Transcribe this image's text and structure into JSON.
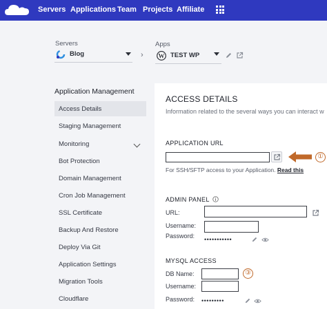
{
  "nav": {
    "logo_icon": "cloud-logo-icon",
    "items": [
      "Servers",
      "Applications",
      "Team",
      "Projects",
      "Affiliate"
    ],
    "apps_grid_icon": "grid-menu-icon"
  },
  "selectors": {
    "servers": {
      "caption": "Servers",
      "value": "Blog",
      "icon": "server-icon"
    },
    "apps": {
      "caption": "Apps",
      "value": "TEST WP",
      "icon": "wordpress-icon"
    },
    "separator": "›"
  },
  "sidebar": {
    "title": "Application Management",
    "items": [
      {
        "label": "Access Details",
        "active": true
      },
      {
        "label": "Staging Management"
      },
      {
        "label": "Monitoring",
        "has_chevron": true
      },
      {
        "label": "Bot Protection"
      },
      {
        "label": "Domain Management"
      },
      {
        "label": "Cron Job Management"
      },
      {
        "label": "SSL Certificate"
      },
      {
        "label": "Backup And Restore"
      },
      {
        "label": "Deploy Via Git"
      },
      {
        "label": "Application Settings"
      },
      {
        "label": "Migration Tools"
      },
      {
        "label": "Cloudflare"
      }
    ]
  },
  "access": {
    "title": "ACCESS DETAILS",
    "description": "Information related to the several ways you can interact w",
    "app_url": {
      "title": "APPLICATION URL",
      "value": "",
      "hint_text": "For SSH/SFTP access to your Application.",
      "hint_link": "Read this"
    },
    "admin_panel": {
      "title": "ADMIN PANEL",
      "url_label": "URL:",
      "url_value": "",
      "username_label": "Username:",
      "username_value": "",
      "password_label": "Password:",
      "password_mask": "•••••••••••"
    },
    "mysql": {
      "title": "MYSQL ACCESS",
      "db_label": "DB Name:",
      "db_value": "",
      "username_label": "Username:",
      "username_value": "",
      "password_label": "Password:",
      "password_mask": "•••••••••"
    }
  },
  "annotations": {
    "marker_1": "①",
    "marker_3": "③",
    "accent": "#c0692a"
  },
  "colors": {
    "topbar": "#2f39bf",
    "accent": "#c0692a"
  }
}
